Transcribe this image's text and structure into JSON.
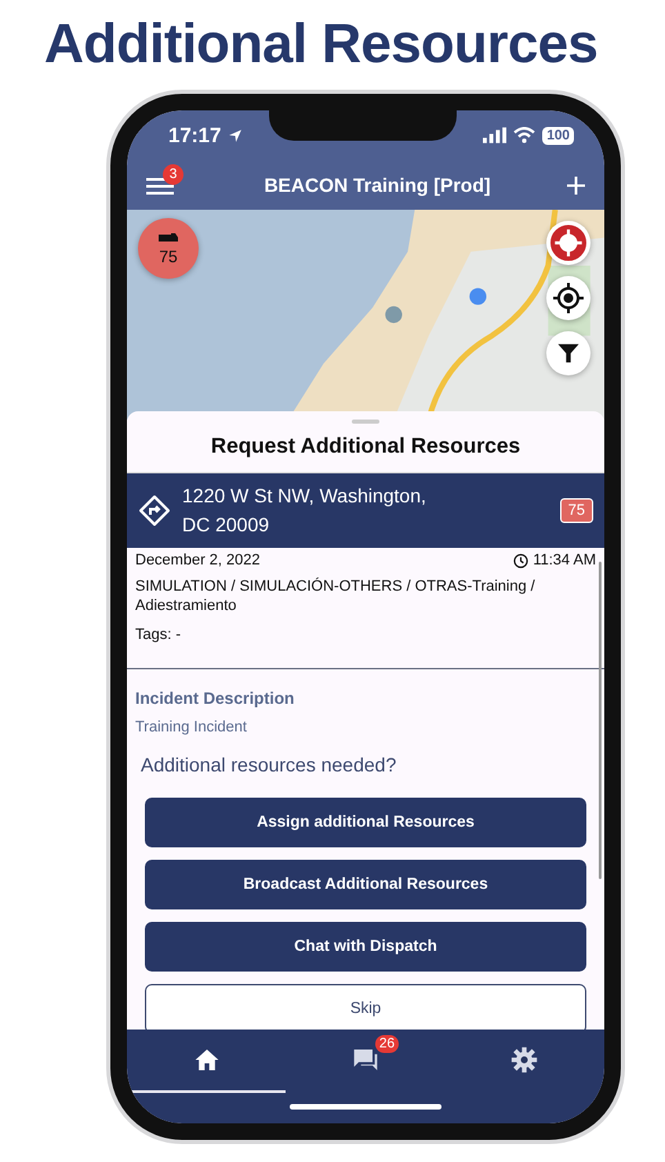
{
  "headline": "Additional Resources",
  "status_bar": {
    "time": "17:17",
    "battery": "100"
  },
  "header": {
    "menu_badge": "3",
    "title": "BEACON Training [Prod]"
  },
  "map": {
    "unit_marker": {
      "label": "75"
    }
  },
  "sheet": {
    "title": "Request Additional Resources",
    "address": {
      "line_1": "1220 W St NW, Washington,",
      "line_2": "DC 20009",
      "unit_badge": "75"
    },
    "date": "December 2, 2022",
    "time": "11:34 AM",
    "type": "SIMULATION / SIMULACIÓN-OTHERS / OTRAS-Training / Adiestramiento",
    "tags": "Tags: -",
    "description_heading": "Incident Description",
    "description": "Training Incident",
    "question": "Additional resources needed?",
    "buttons": [
      {
        "label": "Assign additional Resources",
        "kind": "primary"
      },
      {
        "label": "Broadcast Additional Resources",
        "kind": "primary"
      },
      {
        "label": "Chat with Dispatch",
        "kind": "primary"
      },
      {
        "label": "Skip",
        "kind": "outline"
      }
    ]
  },
  "nav": [
    {
      "kind": "home",
      "selected": true
    },
    {
      "kind": "chat",
      "selected": false,
      "badge": "26"
    },
    {
      "kind": "settings",
      "selected": false
    }
  ]
}
